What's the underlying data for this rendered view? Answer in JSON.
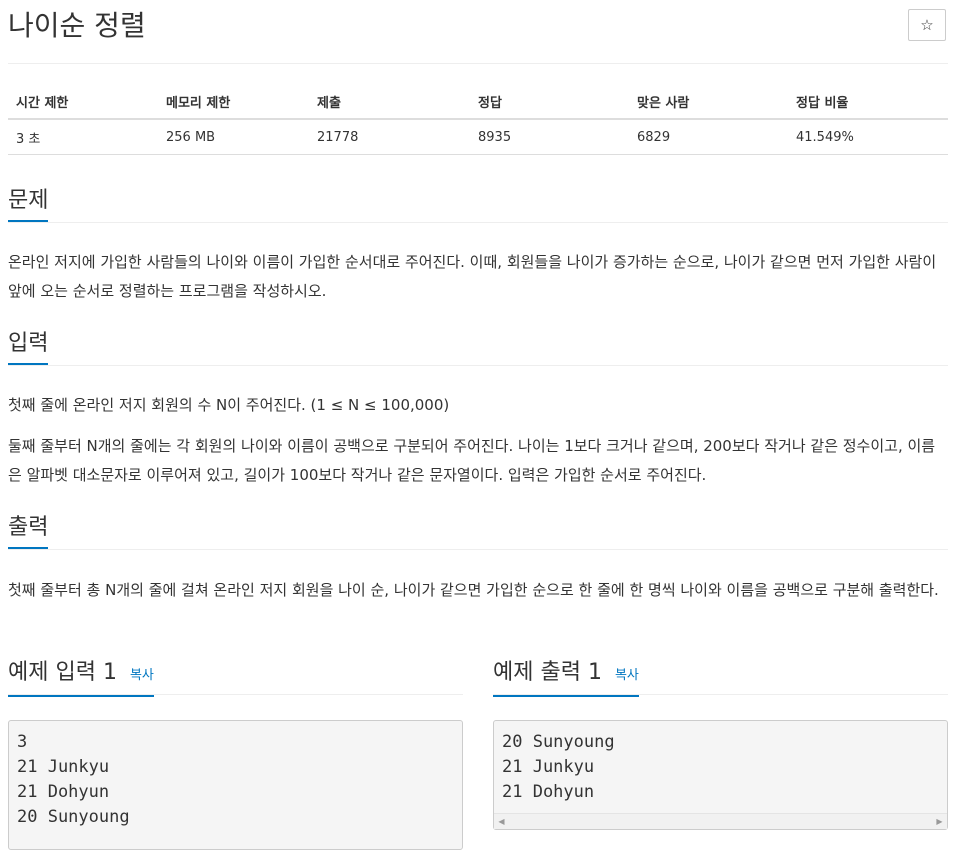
{
  "problem": {
    "title": "나이순 정렬",
    "star_icon": "☆"
  },
  "info_table": {
    "headers": [
      "시간 제한",
      "메모리 제한",
      "제출",
      "정답",
      "맞은 사람",
      "정답 비율"
    ],
    "values": [
      "3 초",
      "256 MB",
      "21778",
      "8935",
      "6829",
      "41.549%"
    ]
  },
  "sections": {
    "description": {
      "heading": "문제",
      "text": "온라인 저지에 가입한 사람들의 나이와 이름이 가입한 순서대로 주어진다. 이때, 회원들을 나이가 증가하는 순으로, 나이가 같으면 먼저 가입한 사람이 앞에 오는 순서로 정렬하는 프로그램을 작성하시오."
    },
    "input": {
      "heading": "입력",
      "line1": "첫째 줄에 온라인 저지 회원의 수 N이 주어진다. (1 ≤ N ≤ 100,000)",
      "line2": "둘째 줄부터 N개의 줄에는 각 회원의 나이와 이름이 공백으로 구분되어 주어진다. 나이는 1보다 크거나 같으며, 200보다 작거나 같은 정수이고, 이름은 알파벳 대소문자로 이루어져 있고, 길이가 100보다 작거나 같은 문자열이다. 입력은 가입한 순서로 주어진다."
    },
    "output": {
      "heading": "출력",
      "text": "첫째 줄부터 총 N개의 줄에 걸쳐 온라인 저지 회원을 나이 순, 나이가 같으면 가입한 순으로 한 줄에 한 명씩 나이와 이름을 공백으로 구분해 출력한다."
    }
  },
  "samples": {
    "copy_label": "복사",
    "input": {
      "heading": "예제 입력 1",
      "content": "3\n21 Junkyu\n21 Dohyun\n20 Sunyoung"
    },
    "output": {
      "heading": "예제 출력 1",
      "content": "20 Sunyoung\n21 Junkyu\n21 Dohyun"
    }
  }
}
